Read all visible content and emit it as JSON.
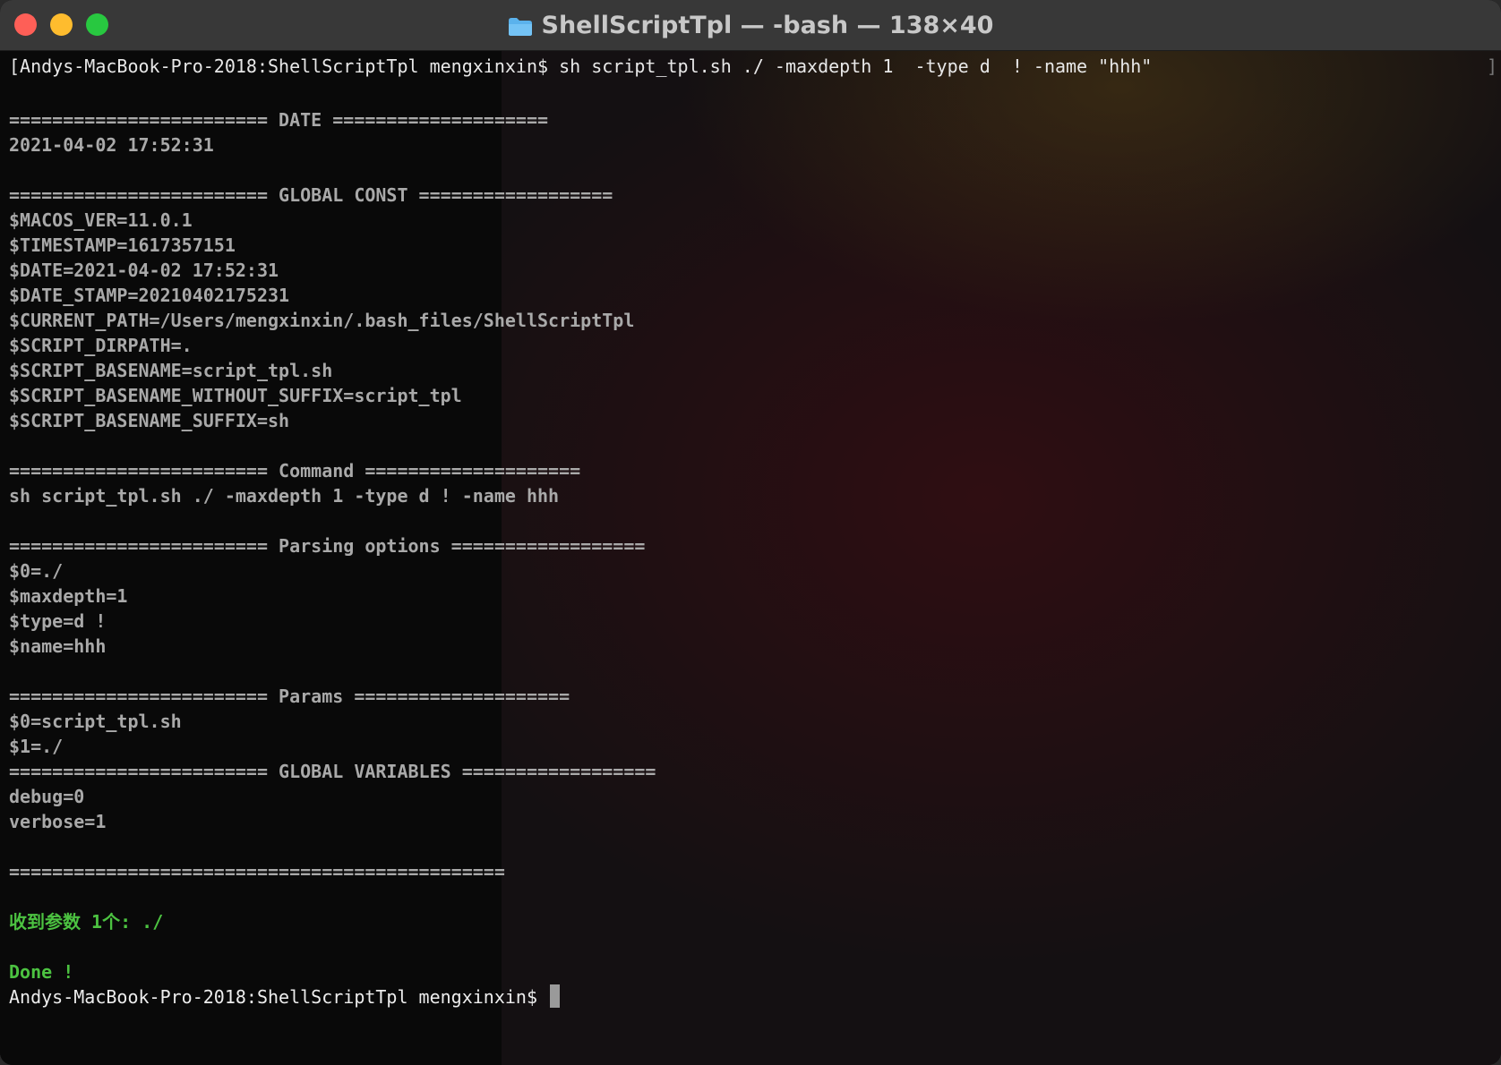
{
  "window": {
    "title": "ShellScriptTpl — -bash — 138×40",
    "folder_icon": "folder-icon"
  },
  "terminal": {
    "command_line": "[Andys-MacBook-Pro-2018:ShellScriptTpl mengxinxin$ sh script_tpl.sh ./ -maxdepth 1  -type d  ! -name \"hhh\"",
    "right_bracket": "]",
    "lines": [
      "",
      "======================== DATE ====================",
      "2021-04-02 17:52:31",
      "",
      "======================== GLOBAL CONST ==================",
      "$MACOS_VER=11.0.1",
      "$TIMESTAMP=1617357151",
      "$DATE=2021-04-02 17:52:31",
      "$DATE_STAMP=20210402175231",
      "$CURRENT_PATH=/Users/mengxinxin/.bash_files/ShellScriptTpl",
      "$SCRIPT_DIRPATH=.",
      "$SCRIPT_BASENAME=script_tpl.sh",
      "$SCRIPT_BASENAME_WITHOUT_SUFFIX=script_tpl",
      "$SCRIPT_BASENAME_SUFFIX=sh",
      "",
      "======================== Command ====================",
      "sh script_tpl.sh ./ -maxdepth 1 -type d ! -name hhh",
      "",
      "======================== Parsing options ==================",
      "$0=./",
      "$maxdepth=1",
      "$type=d !",
      "$name=hhh",
      "",
      "======================== Params ====================",
      "$0=script_tpl.sh",
      "$1=./",
      "======================== GLOBAL VARIABLES ==================",
      "debug=0",
      "verbose=1",
      "",
      "==============================================",
      "",
      "收到参数 1个: ./",
      "",
      "Done !"
    ],
    "green_lines": [
      33,
      35
    ],
    "prompt": "Andys-MacBook-Pro-2018:ShellScriptTpl mengxinxin$ "
  }
}
